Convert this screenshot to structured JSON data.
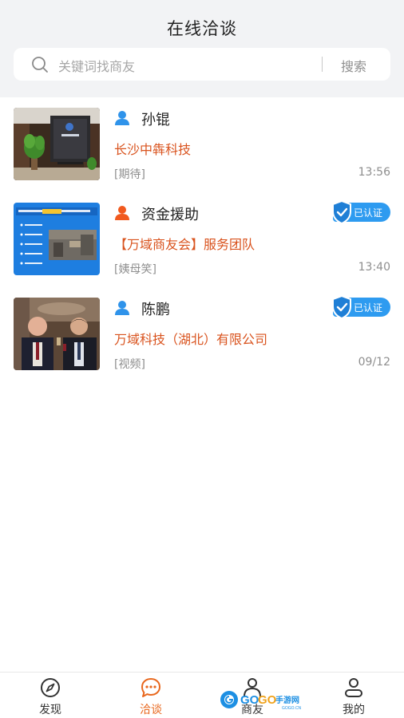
{
  "header": {
    "title": "在线洽谈",
    "search_placeholder": "关键词找商友",
    "search_button": "搜索"
  },
  "chats": [
    {
      "name": "孙锟",
      "company": "长沙中犇科技",
      "tag": "[期待]",
      "time": "13:56",
      "verified": false,
      "icon": "person-icon",
      "icon_color": "#2f93ea"
    },
    {
      "name": "资金援助",
      "company": "【万域商友会】服务团队",
      "tag": "[姨母笑]",
      "time": "13:40",
      "verified": true,
      "verified_label": "已认证",
      "icon": "person-icon",
      "icon_color": "#f1591e"
    },
    {
      "name": "陈鹏",
      "company": "万域科技（湖北）有限公司",
      "tag": "[视频]",
      "time": "09/12",
      "verified": true,
      "verified_label": "已认证",
      "icon": "person-icon",
      "icon_color": "#2f93ea"
    }
  ],
  "tabbar": {
    "active": "洽谈",
    "tabs": [
      {
        "label": "发现",
        "icon": "compass-icon"
      },
      {
        "label": "洽谈",
        "icon": "chat-bubble-icon"
      },
      {
        "label": "商友",
        "icon": "contacts-icon"
      },
      {
        "label": "我的",
        "icon": "profile-icon"
      }
    ]
  },
  "colors": {
    "accent": "#e8671d",
    "company_text": "#d9531e",
    "verified_badge": "#2e9bf0",
    "header_bg": "#f2f3f5"
  },
  "watermark": {
    "text": "GOGO手游网",
    "subtext": "GOGO.CN"
  }
}
